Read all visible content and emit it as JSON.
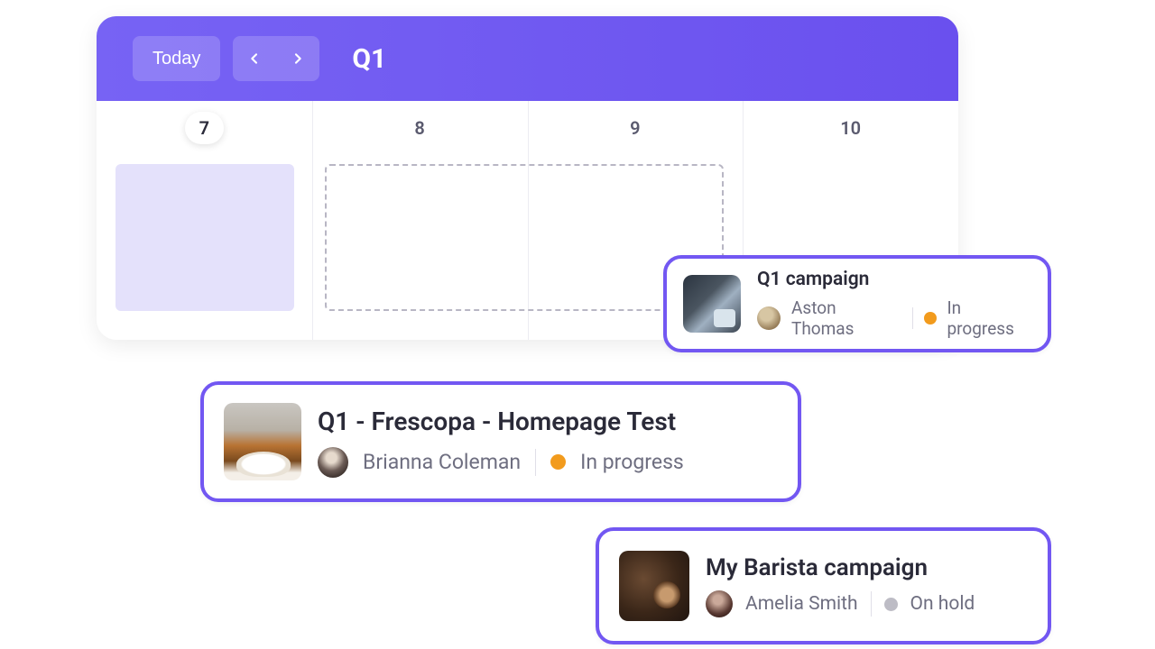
{
  "colors": {
    "accent": "#6E54EF",
    "status_in_progress": "#f29b1d",
    "status_on_hold": "#bdbcc5"
  },
  "header": {
    "today_label": "Today",
    "title": "Q1"
  },
  "days": [
    "7",
    "8",
    "9",
    "10"
  ],
  "cards": [
    {
      "title": "Q1 campaign",
      "owner": "Aston Thomas",
      "status_label": "In progress",
      "status_key": "in_progress"
    },
    {
      "title": "Q1 - Frescopa - Homepage Test",
      "owner": "Brianna Coleman",
      "status_label": "In progress",
      "status_key": "in_progress"
    },
    {
      "title": "My Barista campaign",
      "owner": "Amelia Smith",
      "status_label": "On hold",
      "status_key": "on_hold"
    }
  ]
}
